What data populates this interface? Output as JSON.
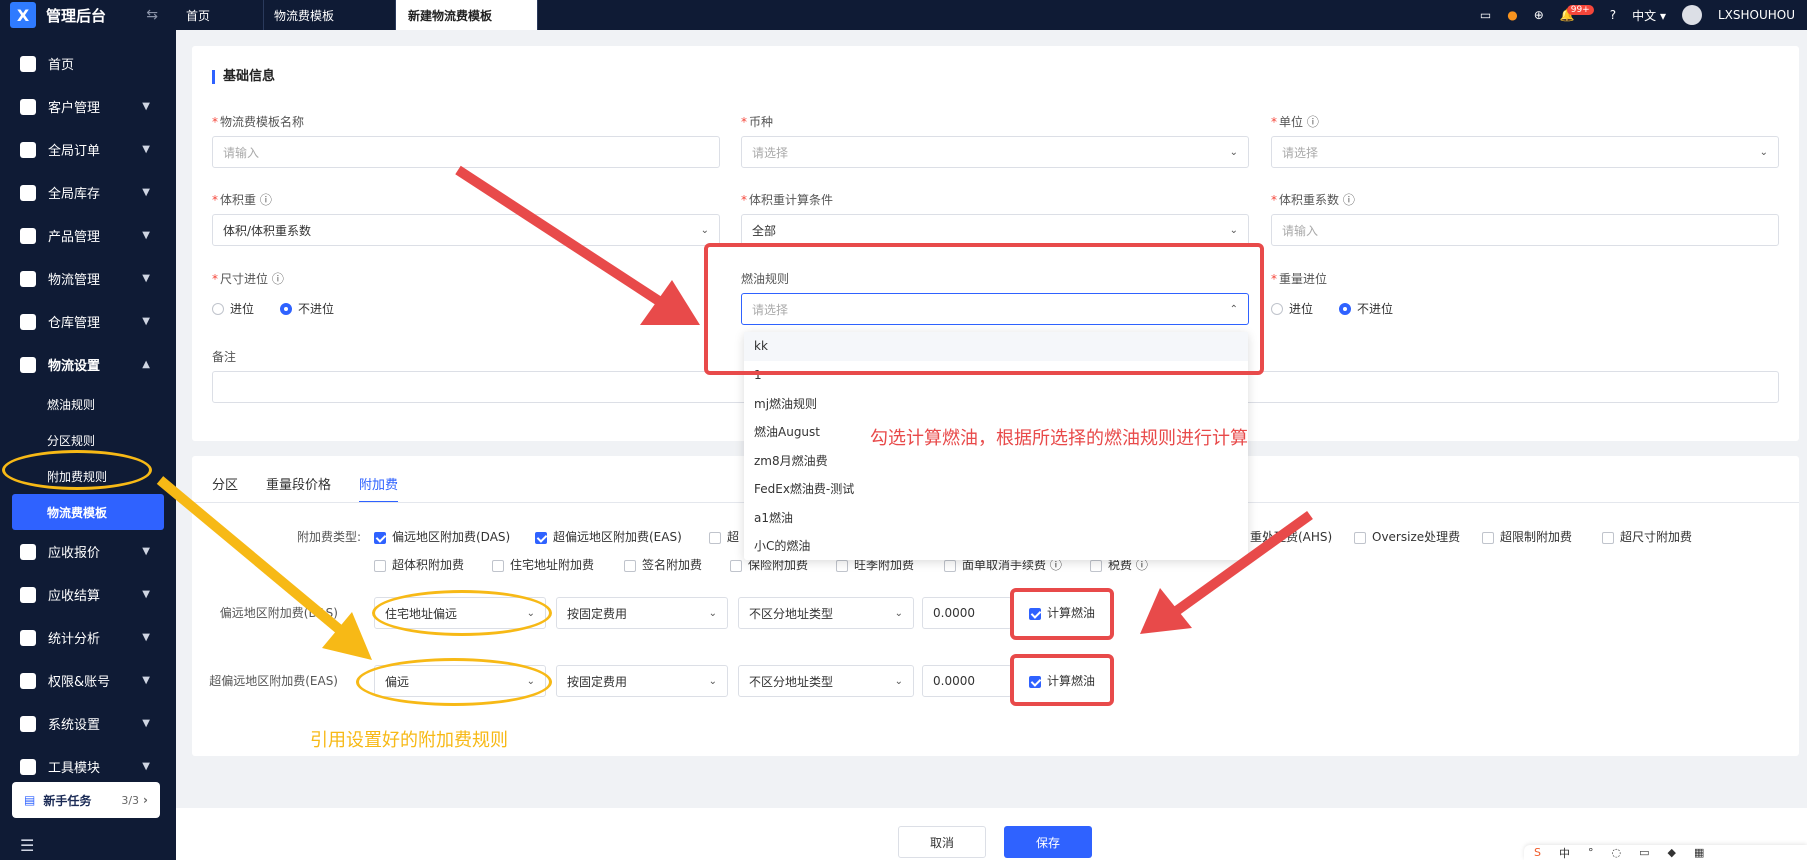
{
  "app": {
    "title": "管理后台",
    "logo_mark": "X"
  },
  "topbar": {
    "tabs": [
      "首页",
      "物流费模板",
      "新建物流费模板"
    ],
    "notification_count": "99+",
    "language": "中文",
    "username": "LXSHOUHOU"
  },
  "sidebar": {
    "items": [
      {
        "label": "首页",
        "icon": "home-icon"
      },
      {
        "label": "客户管理",
        "icon": "users-icon"
      },
      {
        "label": "全局订单",
        "icon": "order-icon"
      },
      {
        "label": "全局库存",
        "icon": "inventory-icon"
      },
      {
        "label": "产品管理",
        "icon": "product-icon"
      },
      {
        "label": "物流管理",
        "icon": "truck-icon"
      },
      {
        "label": "仓库管理",
        "icon": "warehouse-icon"
      },
      {
        "label": "物流设置",
        "icon": "logistics-settings-icon"
      }
    ],
    "subitems": [
      "燃油规则",
      "分区规则",
      "附加费规则",
      "物流费模板"
    ],
    "items_after": [
      {
        "label": "应收报价",
        "icon": "quote-icon"
      },
      {
        "label": "应收结算",
        "icon": "settlement-icon"
      },
      {
        "label": "统计分析",
        "icon": "chart-icon"
      },
      {
        "label": "权限&账号",
        "icon": "permission-icon"
      },
      {
        "label": "系统设置",
        "icon": "settings-icon"
      },
      {
        "label": "工具模块",
        "icon": "tool-icon"
      }
    ],
    "task": {
      "label": "新手任务",
      "count": "3/3"
    }
  },
  "basic": {
    "title": "基础信息",
    "template_name": {
      "label": "物流费模板名称",
      "placeholder": "请输入"
    },
    "currency": {
      "label": "币种",
      "placeholder": "请选择"
    },
    "unit": {
      "label": "单位",
      "placeholder": "请选择"
    },
    "volume_weight": {
      "label": "体积重",
      "value": "体积/体积重系数"
    },
    "volume_condition": {
      "label": "体积重计算条件",
      "value": "全部"
    },
    "volume_factor": {
      "label": "体积重系数",
      "placeholder": "请输入"
    },
    "size_rounding": {
      "label": "尺寸进位",
      "options": [
        "进位",
        "不进位"
      ]
    },
    "fuel_rule": {
      "label": "燃油规则",
      "placeholder": "请选择"
    },
    "weight_rounding": {
      "label": "重量进位",
      "options": [
        "进位",
        "不进位"
      ]
    },
    "remark": {
      "label": "备注"
    }
  },
  "fuel_dropdown": [
    "kk",
    "1",
    "mj燃油规则",
    "燃油August",
    "zm8月燃油费",
    "FedEx燃油费-测试",
    "a1燃油",
    "小C的燃油"
  ],
  "tabs": [
    "分区",
    "重量段价格",
    "附加费"
  ],
  "surcharge": {
    "type_label": "附加费类型:",
    "row1": [
      {
        "label": "偏远地区附加费(DAS)",
        "checked": true
      },
      {
        "label": "超偏远地区附加费(EAS)",
        "checked": true
      },
      {
        "label": "超",
        "checked": false
      },
      {
        "label": "重处理费(AHS)",
        "checked": false
      },
      {
        "label": "Oversize处理费",
        "checked": false
      },
      {
        "label": "超限制附加费",
        "checked": false
      },
      {
        "label": "超尺寸附加费",
        "checked": false
      }
    ],
    "row2": [
      {
        "label": "超体积附加费",
        "checked": false
      },
      {
        "label": "住宅地址附加费",
        "checked": false
      },
      {
        "label": "签名附加费",
        "checked": false
      },
      {
        "label": "保险附加费",
        "checked": false
      },
      {
        "label": "旺季附加费",
        "checked": false
      },
      {
        "label": "面单取消手续费",
        "checked": false
      },
      {
        "label": "税费",
        "checked": false
      }
    ],
    "das": {
      "label": "偏远地区附加费(DAS)",
      "rule": "住宅地址偏远",
      "fee_type": "按固定费用",
      "addr_type": "不区分地址类型",
      "amount": "0.0000",
      "fuel_label": "计算燃油"
    },
    "eas": {
      "label": "超偏远地区附加费(EAS)",
      "rule": "偏远",
      "fee_type": "按固定费用",
      "addr_type": "不区分地址类型",
      "amount": "0.0000",
      "fuel_label": "计算燃油"
    }
  },
  "footer": {
    "cancel": "取消",
    "save": "保存"
  },
  "annotations": {
    "red_text": "勾选计算燃油，根据所选择的燃油规则进行计算",
    "yellow_text": "引用设置好的附加费规则",
    "red_color": "#e84a4a",
    "yellow_color": "#f7b916"
  },
  "watermark": "LXSHOUHOU"
}
